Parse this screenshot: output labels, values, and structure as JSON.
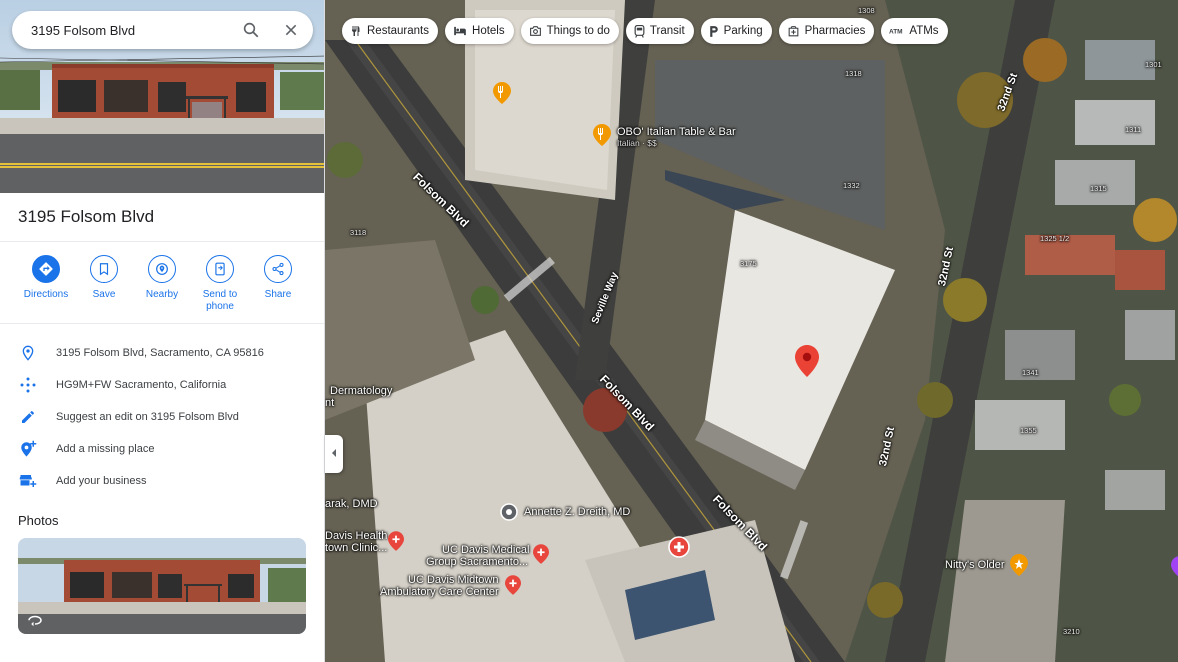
{
  "search": {
    "value": "3195 Folsom Blvd",
    "search_icon": "search-icon",
    "clear_icon": "close-icon"
  },
  "place": {
    "title": "3195 Folsom Blvd"
  },
  "actions": [
    {
      "label": "Directions",
      "icon": "directions-icon"
    },
    {
      "label": "Save",
      "icon": "bookmark-icon"
    },
    {
      "label": "Nearby",
      "icon": "nearby-icon"
    },
    {
      "label": "Send to phone",
      "icon": "send-to-phone-icon"
    },
    {
      "label": "Share",
      "icon": "share-icon"
    }
  ],
  "info": [
    {
      "text": "3195 Folsom Blvd, Sacramento, CA 95816",
      "icon": "location-pin-icon"
    },
    {
      "text": "HG9M+FW Sacramento, California",
      "icon": "plus-code-icon"
    },
    {
      "text": "Suggest an edit on 3195 Folsom Blvd",
      "icon": "pencil-icon"
    },
    {
      "text": "Add a missing place",
      "icon": "add-place-icon"
    },
    {
      "text": "Add your business",
      "icon": "add-business-icon"
    }
  ],
  "photos": {
    "header": "Photos"
  },
  "chips": [
    {
      "label": "Restaurants",
      "icon": "fork-knife-icon"
    },
    {
      "label": "Hotels",
      "icon": "bed-icon"
    },
    {
      "label": "Things to do",
      "icon": "camera-icon"
    },
    {
      "label": "Transit",
      "icon": "transit-icon"
    },
    {
      "label": "Parking",
      "icon": "parking-icon"
    },
    {
      "label": "Pharmacies",
      "icon": "pharmacy-icon"
    },
    {
      "label": "ATMs",
      "icon": "atm-icon"
    }
  ],
  "map": {
    "streets": {
      "folsom_1": "Folsom Blvd",
      "folsom_2": "Folsom Blvd",
      "folsom_3": "Folsom Blvd",
      "seville": "Seville Way",
      "s32_1": "32nd St",
      "s32_2": "32nd St",
      "s32_3": "32nd St"
    },
    "places": {
      "obo": "OBO' Italian Table & Bar",
      "obo_sub": "Italian · $$",
      "dermatology": "Dermatology",
      "dermatology_t": "nt",
      "annette": "Annette Z. Dreith, MD",
      "parak": "arak, DMD",
      "ucd_health_1": "Davis Health",
      "ucd_health_2": "town Clinic...",
      "ucd_med_1": "UC Davis Medical",
      "ucd_med_2": "Group Sacramento...",
      "ucd_midtown_1": "UC Davis Midtown",
      "ucd_midtown_2": "Ambulatory Care Center",
      "nittys": "Nitty's Older"
    },
    "numbers": {
      "n1308": "1308",
      "n1318": "1318",
      "n1301": "1301",
      "n1311": "1311",
      "n1315": "1315",
      "n1325": "1325 1/2",
      "n1341": "1341",
      "n1355": "1355",
      "n1332": "1332",
      "n3175": "3175",
      "n3118": "3118",
      "n3210": "3210"
    },
    "colors": {
      "pin": "#ea4335",
      "poi_orange": "#f29900",
      "poi_red": "#e8453c"
    }
  }
}
